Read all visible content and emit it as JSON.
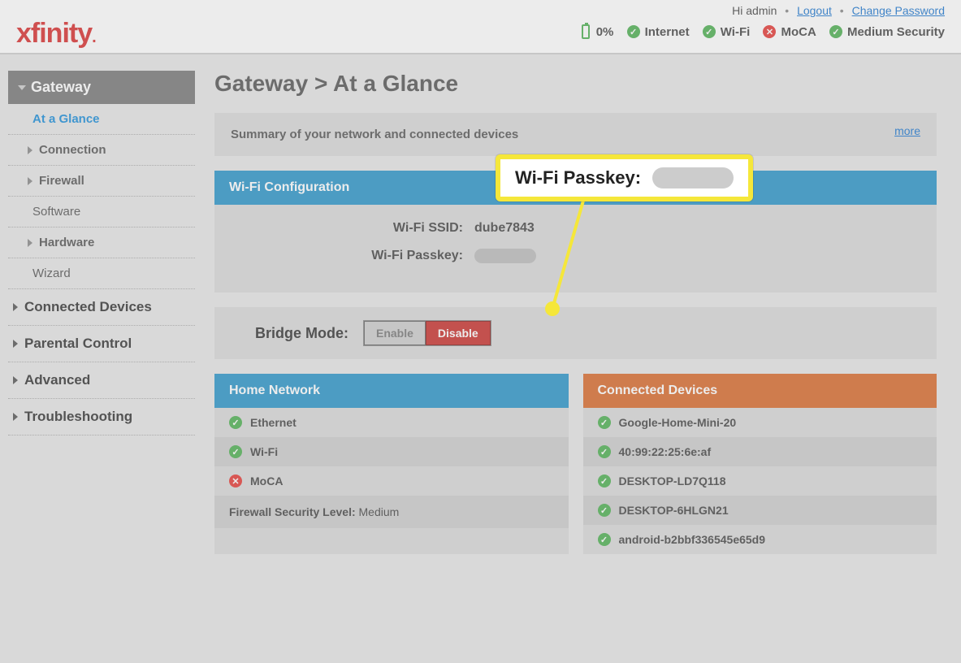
{
  "logo": "xfinity",
  "top_right": {
    "greeting": "Hi admin",
    "logout": "Logout",
    "change_password": "Change Password"
  },
  "status": {
    "battery_pct": "0%",
    "internet": "Internet",
    "wifi": "Wi-Fi",
    "moca": "MoCA",
    "security": "Medium Security"
  },
  "sidebar": {
    "gateway": "Gateway",
    "at_a_glance": "At a Glance",
    "connection": "Connection",
    "firewall": "Firewall",
    "software": "Software",
    "hardware": "Hardware",
    "wizard": "Wizard",
    "connected_devices": "Connected Devices",
    "parental_control": "Parental Control",
    "advanced": "Advanced",
    "troubleshooting": "Troubleshooting"
  },
  "page_title": "Gateway > At a Glance",
  "summary_text": "Summary of your network and connected devices",
  "more_label": "more",
  "wifi_config": {
    "header": "Wi-Fi Configuration",
    "ssid_label": "Wi-Fi SSID:",
    "ssid_value": "dube7843",
    "passkey_label": "Wi-Fi Passkey:"
  },
  "bridge": {
    "label": "Bridge Mode:",
    "enable": "Enable",
    "disable": "Disable"
  },
  "home_network": {
    "header": "Home Network",
    "items": [
      "Ethernet",
      "Wi-Fi",
      "MoCA"
    ],
    "firewall_label": "Firewall Security Level: ",
    "firewall_value": "Medium"
  },
  "connected_devices": {
    "header": "Connected Devices",
    "items": [
      "Google-Home-Mini-20",
      "40:99:22:25:6e:af",
      "DESKTOP-LD7Q118",
      "DESKTOP-6HLGN21",
      "android-b2bbf336545e65d9"
    ]
  },
  "callout": {
    "label": "Wi-Fi Passkey:"
  }
}
